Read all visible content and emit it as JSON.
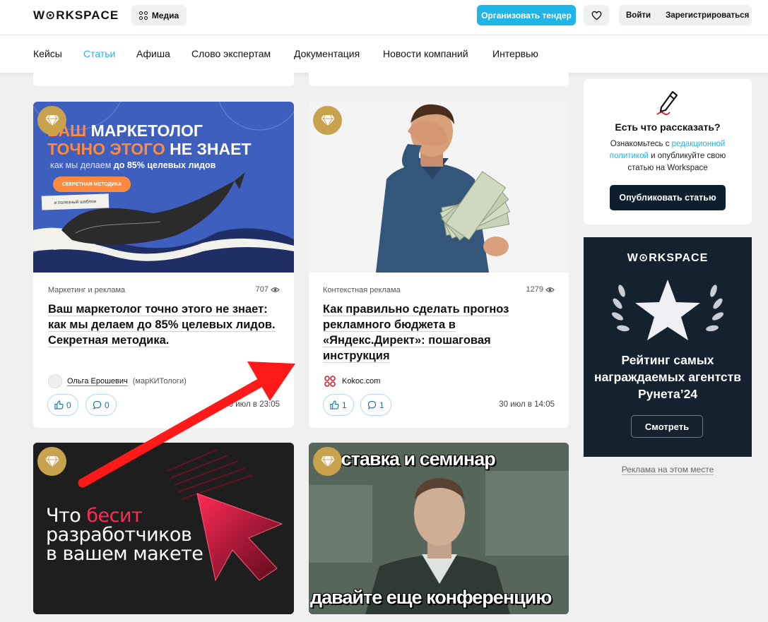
{
  "header": {
    "logo": "W⊙RKSPACE",
    "media_label": "Медиа",
    "tender_label": "Организовать тендер",
    "login_label": "Войти",
    "register_label": "Зарегистрироваться"
  },
  "nav": {
    "items": [
      "Кейсы",
      "Статьи",
      "Афиша",
      "Слово экспертам",
      "Документация",
      "Новости компаний",
      "Интервью"
    ],
    "active_index": 1
  },
  "cards": [
    {
      "image_text": {
        "line1a": "ВАШ ",
        "line1b": "МАРКЕТОЛОГ",
        "line2a": "ТОЧНО ЭТОГО ",
        "line2b": "НЕ ЗНАЕТ",
        "line3a": "как мы делаем ",
        "line3b": "до 85% целевых лидов",
        "pill": "СЕКРЕТНАЯ МЕТОДИКА",
        "sub": "и полезный шаблон"
      },
      "category": "Маркетинг и реклама",
      "views": "707",
      "title": "Ваш маркетолог точно этого не знает: как мы делаем до 85% целевых лидов. Секретная методика.",
      "author": "Ольга Ерошевич",
      "org": "(марКИТологи)",
      "likes": "0",
      "comments": "0",
      "date": "30 июл в 23:05"
    },
    {
      "category": "Контекстная реклама",
      "views": "1279",
      "title": "Как правильно сделать прогноз рекламного бюджета в «Яндекс.Директ»: пошаговая инструкция",
      "author": "Kokoc.com",
      "likes": "1",
      "comments": "1",
      "date": "30 июл в 14:05"
    },
    {
      "image_text": {
        "line1a": "Что ",
        "line1b": "бесит",
        "line2": "разработчиков",
        "line3": "в вашем макете"
      }
    },
    {
      "image_text": {
        "top": "выставка и семинар",
        "bottom": "давайте еще конференцию"
      }
    }
  ],
  "sidebar": {
    "title": "Есть что рассказать?",
    "text_before": "Ознакомьтесь с ",
    "text_link": "редакционной политикой",
    "text_after": " и опубликуйте свою статью на Workspace",
    "publish_label": "Опубликовать статью"
  },
  "ad": {
    "logo": "W⊙RKSPACE",
    "title": "Рейтинг самых награждаемых агентств Рунета’24",
    "button": "Смотреть",
    "link": "Реклама на этом месте"
  },
  "colors": {
    "accent": "#1fb5e6",
    "dark": "#0d1e2c",
    "badge": "#c9a24e",
    "arrow": "#ff1a1a"
  }
}
